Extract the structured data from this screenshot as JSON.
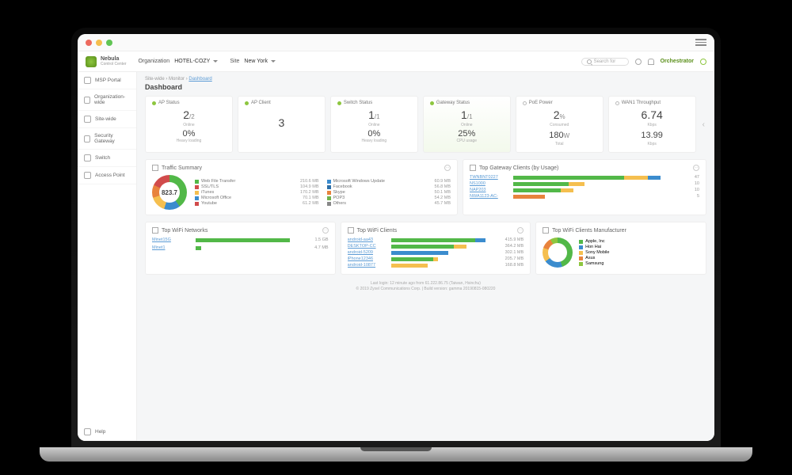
{
  "brand": {
    "name": "Nebula",
    "subtitle": "Control Center"
  },
  "topbar": {
    "org_label": "Organization",
    "org_value": "HOTEL-COZY",
    "site_label": "Site",
    "site_value": "New York",
    "search_placeholder": "Search for",
    "orchestrator": "Orchestrator"
  },
  "sidebar": {
    "items": [
      {
        "label": "MSP Portal"
      },
      {
        "label": "Organization-wide"
      },
      {
        "label": "Site-wide"
      },
      {
        "label": "Security Gateway"
      },
      {
        "label": "Switch"
      },
      {
        "label": "Access Point"
      }
    ],
    "help": "Help"
  },
  "crumbs": {
    "a": "Site-wide",
    "b": "Monitor",
    "c": "Dashboard"
  },
  "page_title": "Dashboard",
  "cards": {
    "ap_status": {
      "title": "AP Status",
      "num": "2",
      "den": "/2",
      "sub1": "Online",
      "pct": "0%",
      "sub2": "Heavy loading"
    },
    "ap_client": {
      "title": "AP Client",
      "num": "3"
    },
    "switch_status": {
      "title": "Switch Status",
      "num": "1",
      "den": "/1",
      "sub1": "Online",
      "pct": "0%",
      "sub2": "Heavy loading"
    },
    "gateway_status": {
      "title": "Gateway Status",
      "num": "1",
      "den": "/1",
      "sub1": "Online",
      "pct": "25%",
      "sub2": "CPU usage"
    },
    "poe": {
      "title": "PoE Power",
      "num": "2",
      "unit1": "%",
      "sub1": "Consumed",
      "num2": "180",
      "unit2": "W",
      "sub2": "Total"
    },
    "wan": {
      "title": "WAN1 Throughput",
      "num": "6.74",
      "unit1": "Kbps",
      "num2": "13.99",
      "unit2": "Kbps"
    }
  },
  "traffic": {
    "title": "Traffic Summary",
    "total": "823.7",
    "items": [
      [
        "#52b848",
        "Web File Transfer",
        "210.6 MB",
        "#3b8cce",
        "Microsoft Windows Update",
        "60.9 MB"
      ],
      [
        "#d14b4b",
        "SSL/TLS",
        "104.9 MB",
        "#2d6fa8",
        "Facebook",
        "56.8 MB"
      ],
      [
        "#f5bf4f",
        "iTunes",
        "170.2 MB",
        "#e8833d",
        "Skype",
        "50.1 MB"
      ],
      [
        "#3b8cce",
        "Microsoft Office",
        "70.1 MB",
        "#6fb24b",
        "POP3",
        "54.2 MB"
      ],
      [
        "#d14b4b",
        "Youtube",
        "61.2 MB",
        "#888888",
        "Others",
        "45.7 MB"
      ]
    ]
  },
  "gateway_clients": {
    "title": "Top Gateway Clients (by Usage)",
    "rows": [
      {
        "name": "TWNBNT0227",
        "segs": [
          [
            "#52b848",
            70
          ],
          [
            "#f5bf4f",
            15
          ],
          [
            "#3b8cce",
            8
          ]
        ],
        "val": "47"
      },
      {
        "name": "NS1000",
        "segs": [
          [
            "#52b848",
            35
          ],
          [
            "#f5bf4f",
            10
          ]
        ],
        "val": "10"
      },
      {
        "name": "NAP203",
        "segs": [
          [
            "#52b848",
            30
          ],
          [
            "#f5bf4f",
            8
          ]
        ],
        "val": "10"
      },
      {
        "name": "NWA1123-AC-",
        "segs": [
          [
            "#e8833d",
            20
          ]
        ],
        "val": "5"
      }
    ]
  },
  "wifi_nets": {
    "title": "Top WiFi Networks",
    "rows": [
      {
        "name": "Minet15G",
        "segs": [
          [
            "#52b848",
            90
          ]
        ],
        "val": "1.5 GB"
      },
      {
        "name": "Minet1",
        "segs": [
          [
            "#52b848",
            5
          ]
        ],
        "val": "4.7 MB"
      }
    ]
  },
  "wifi_clients": {
    "title": "Top WiFi Clients",
    "rows": [
      {
        "name": "android-aa43",
        "segs": [
          [
            "#52b848",
            80
          ],
          [
            "#3b8cce",
            10
          ]
        ],
        "val": "415.9 MB"
      },
      {
        "name": "DESKTOP-CC",
        "segs": [
          [
            "#52b848",
            60
          ],
          [
            "#f5bf4f",
            12
          ]
        ],
        "val": "364.2 MB"
      },
      {
        "name": "android-5209",
        "segs": [
          [
            "#3b8cce",
            55
          ]
        ],
        "val": "302.1 MB"
      },
      {
        "name": "iPhone12346",
        "segs": [
          [
            "#52b848",
            40
          ],
          [
            "#f5bf4f",
            5
          ]
        ],
        "val": "205.7 MB"
      },
      {
        "name": "android-10877",
        "segs": [
          [
            "#f5bf4f",
            35
          ]
        ],
        "val": "168.8 MB"
      }
    ]
  },
  "mfr": {
    "title": "Top WiFi Clients Manufacturer",
    "items": [
      [
        "#52b848",
        "Apple, Inc"
      ],
      [
        "#3b8cce",
        "Hon Hai"
      ],
      [
        "#f5bf4f",
        "Sony Mobile"
      ],
      [
        "#e8833d",
        "Asus"
      ],
      [
        "#8dc63f",
        "Samsung"
      ]
    ]
  },
  "footer": {
    "l1": "Last login: 12 minute ago from 61.222.86.75 (Taiwan, Hsinchu)",
    "l2": "© 2019 Zyxel Communications Corp. | Build version: gamma 20190815-080220"
  }
}
